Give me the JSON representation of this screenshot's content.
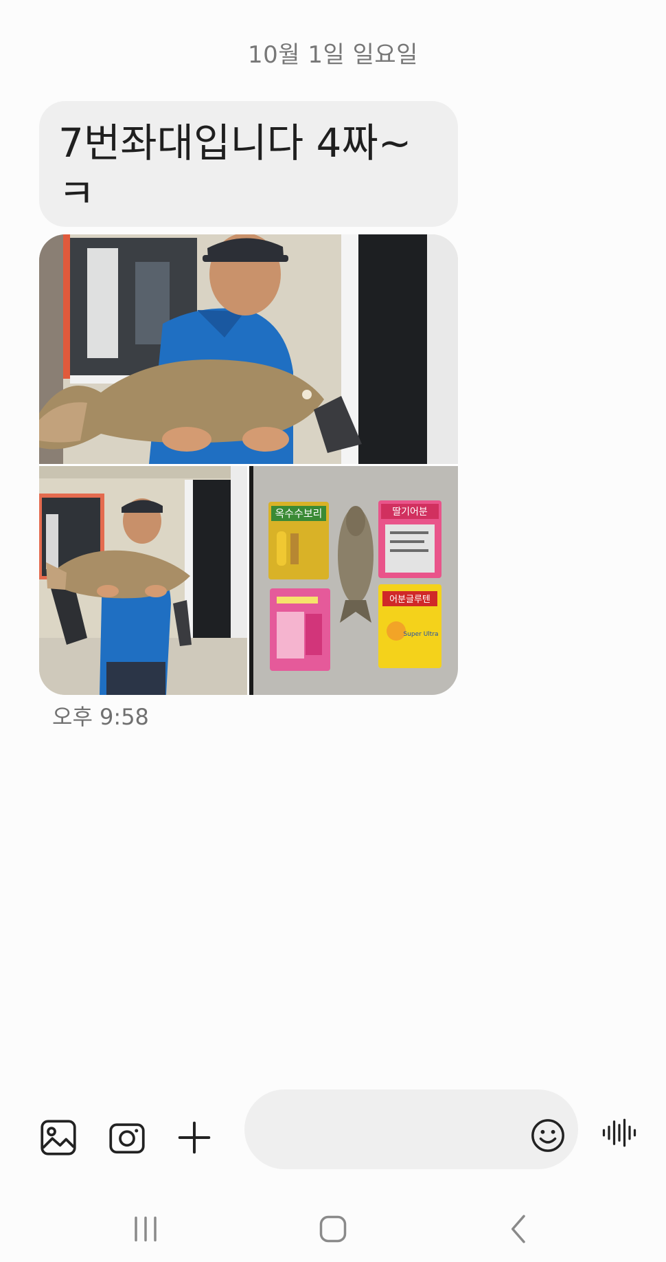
{
  "conversation": {
    "date_header": "10월 1일 일요일",
    "message_text": "7번좌대입니다 4짜~ㅋ",
    "timestamp": "오후 9:58"
  },
  "photo_labels": {
    "bag1": "옥수수보리",
    "bag2": "딸기어분",
    "bag3": "어분글루텐",
    "bag3_sub": "Super Ultra"
  },
  "composer": {
    "placeholder": ""
  },
  "icons": {
    "gallery": "gallery-icon",
    "camera": "camera-icon",
    "plus": "plus-icon",
    "emoji": "emoji-icon",
    "voice": "voice-icon",
    "recents": "recents-icon",
    "home": "home-icon",
    "back": "back-icon"
  }
}
